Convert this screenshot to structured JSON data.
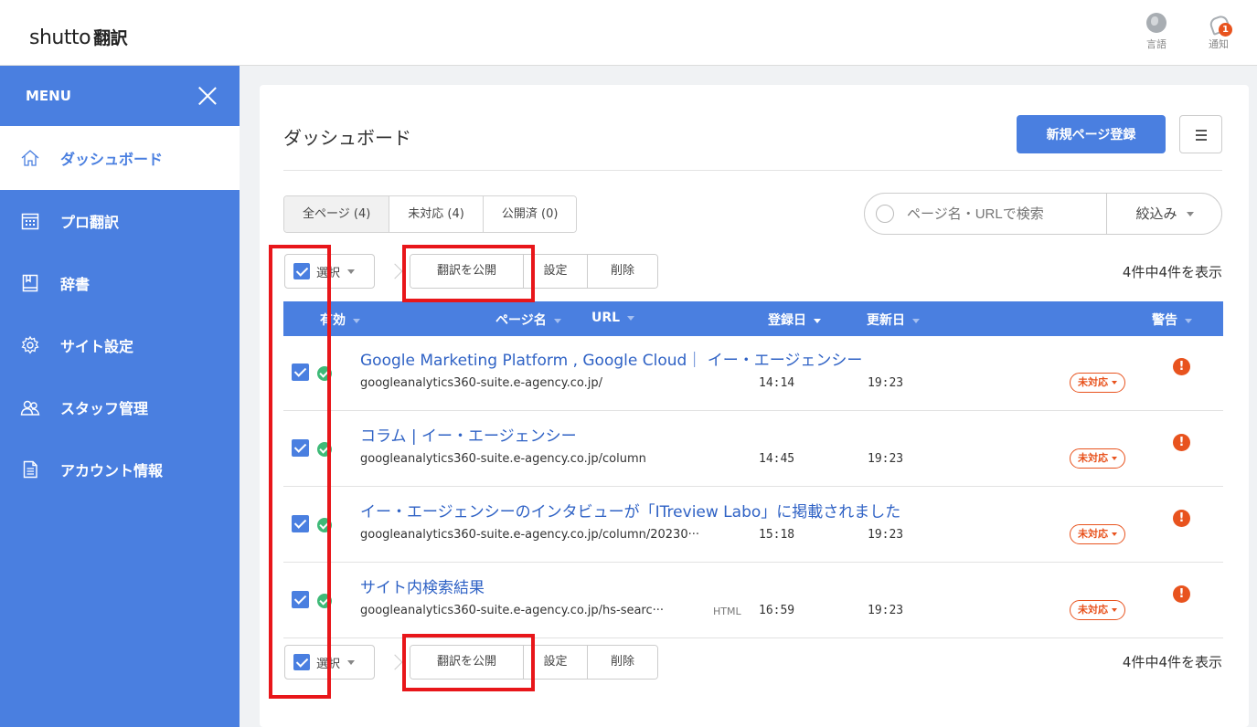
{
  "header": {
    "logo_latin": "shutto",
    "logo_jp": "翻訳",
    "language_label": "言語",
    "notify_label": "通知",
    "notify_count": "1"
  },
  "sidebar": {
    "menu_label": "MENU",
    "items": [
      {
        "label": "ダッシュボード",
        "icon": "home-icon"
      },
      {
        "label": "プロ翻訳",
        "icon": "calendar-icon"
      },
      {
        "label": "辞書",
        "icon": "book-icon"
      },
      {
        "label": "サイト設定",
        "icon": "gear-icon"
      },
      {
        "label": "スタッフ管理",
        "icon": "users-icon"
      },
      {
        "label": "アカウント情報",
        "icon": "document-icon"
      }
    ]
  },
  "main": {
    "title": "ダッシュボード",
    "new_page_button": "新規ページ登録",
    "tabs": [
      {
        "label": "全ページ (4)"
      },
      {
        "label": "未対応 (4)"
      },
      {
        "label": "公開済 (0)"
      }
    ],
    "search": {
      "placeholder": "ページ名・URLで検索"
    },
    "filter_label": "絞込み",
    "toolbar": {
      "select_label": "選択",
      "publish_label": "翻訳を公開",
      "settings_label": "設定",
      "delete_label": "削除",
      "count_text": "4件中4件を表示"
    },
    "columns": {
      "enabled": "有効",
      "page_name": "ページ名",
      "url": "URL",
      "registered": "登録日",
      "updated": "更新日",
      "warning": "警告"
    },
    "rows": [
      {
        "title": "Google Marketing Platform , Google Cloud｜ イー・エージェンシー",
        "url": "googleanalytics360-suite.e-agency.co.jp/",
        "html_tag": "",
        "registered": "14:14",
        "updated": "19:23",
        "status": "未対応"
      },
      {
        "title": "コラム | イー・エージェンシー",
        "url": "googleanalytics360-suite.e-agency.co.jp/column",
        "html_tag": "",
        "registered": "14:45",
        "updated": "19:23",
        "status": "未対応"
      },
      {
        "title": "イー・エージェンシーのインタビューが「ITreview Labo」に掲載されました",
        "url": "googleanalytics360-suite.e-agency.co.jp/column/20230···",
        "html_tag": "",
        "registered": "15:18",
        "updated": "19:23",
        "status": "未対応"
      },
      {
        "title": "サイト内検索結果",
        "url": "googleanalytics360-suite.e-agency.co.jp/hs-searc···",
        "html_tag": "HTML",
        "registered": "16:59",
        "updated": "19:23",
        "status": "未対応"
      }
    ],
    "warn_glyph": "!"
  },
  "colors": {
    "brand_blue": "#4a7fe0",
    "link_blue": "#2f62c5",
    "status_orange": "#e8531e",
    "ok_green": "#3fba78",
    "highlight_red": "#e8161a"
  }
}
